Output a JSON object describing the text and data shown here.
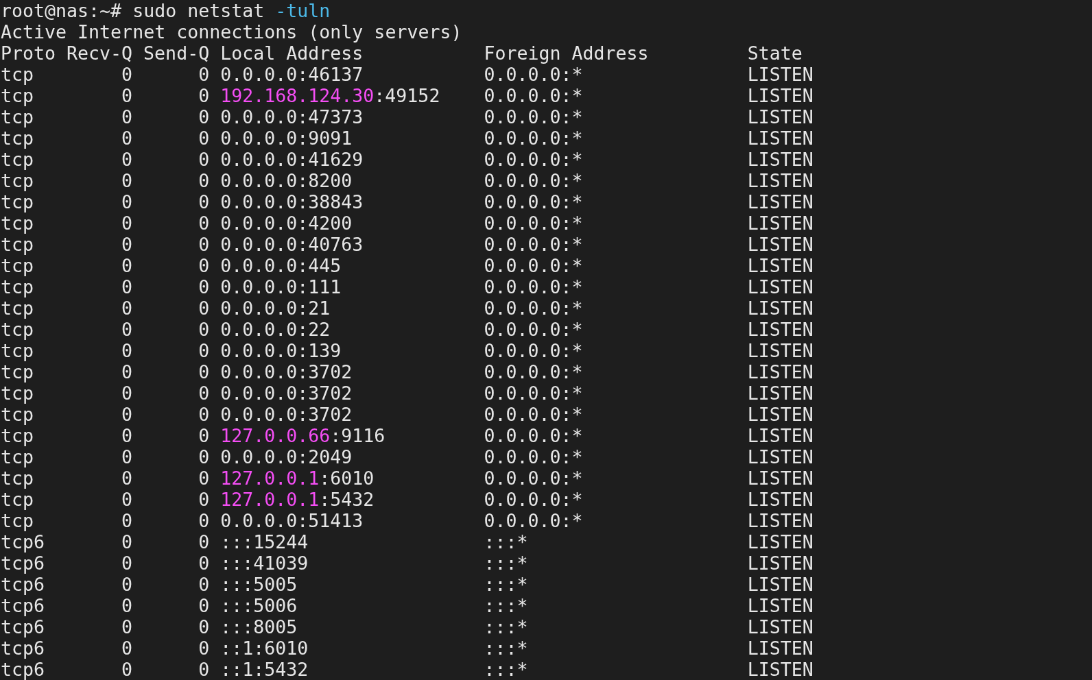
{
  "terminal": {
    "prompt": "root@nas:~#",
    "command": "sudo netstat",
    "option": "-tuln",
    "title": "Active Internet connections (only servers)",
    "table": {
      "columns": [
        "Proto",
        "Recv-Q",
        "Send-Q",
        "Local Address",
        "Foreign Address",
        "State"
      ],
      "rows": [
        {
          "proto": "tcp",
          "recv_q": "0",
          "send_q": "0",
          "local_address": {
            "host": "0.0.0.0",
            "port": ":46137",
            "highlighted": false
          },
          "foreign_address": "0.0.0.0:*",
          "state": "LISTEN"
        },
        {
          "proto": "tcp",
          "recv_q": "0",
          "send_q": "0",
          "local_address": {
            "host": "192.168.124.30",
            "port": ":49152",
            "highlighted": true
          },
          "foreign_address": "0.0.0.0:*",
          "state": "LISTEN"
        },
        {
          "proto": "tcp",
          "recv_q": "0",
          "send_q": "0",
          "local_address": {
            "host": "0.0.0.0",
            "port": ":47373",
            "highlighted": false
          },
          "foreign_address": "0.0.0.0:*",
          "state": "LISTEN"
        },
        {
          "proto": "tcp",
          "recv_q": "0",
          "send_q": "0",
          "local_address": {
            "host": "0.0.0.0",
            "port": ":9091",
            "highlighted": false
          },
          "foreign_address": "0.0.0.0:*",
          "state": "LISTEN"
        },
        {
          "proto": "tcp",
          "recv_q": "0",
          "send_q": "0",
          "local_address": {
            "host": "0.0.0.0",
            "port": ":41629",
            "highlighted": false
          },
          "foreign_address": "0.0.0.0:*",
          "state": "LISTEN"
        },
        {
          "proto": "tcp",
          "recv_q": "0",
          "send_q": "0",
          "local_address": {
            "host": "0.0.0.0",
            "port": ":8200",
            "highlighted": false
          },
          "foreign_address": "0.0.0.0:*",
          "state": "LISTEN"
        },
        {
          "proto": "tcp",
          "recv_q": "0",
          "send_q": "0",
          "local_address": {
            "host": "0.0.0.0",
            "port": ":38843",
            "highlighted": false
          },
          "foreign_address": "0.0.0.0:*",
          "state": "LISTEN"
        },
        {
          "proto": "tcp",
          "recv_q": "0",
          "send_q": "0",
          "local_address": {
            "host": "0.0.0.0",
            "port": ":4200",
            "highlighted": false
          },
          "foreign_address": "0.0.0.0:*",
          "state": "LISTEN"
        },
        {
          "proto": "tcp",
          "recv_q": "0",
          "send_q": "0",
          "local_address": {
            "host": "0.0.0.0",
            "port": ":40763",
            "highlighted": false
          },
          "foreign_address": "0.0.0.0:*",
          "state": "LISTEN"
        },
        {
          "proto": "tcp",
          "recv_q": "0",
          "send_q": "0",
          "local_address": {
            "host": "0.0.0.0",
            "port": ":445",
            "highlighted": false
          },
          "foreign_address": "0.0.0.0:*",
          "state": "LISTEN"
        },
        {
          "proto": "tcp",
          "recv_q": "0",
          "send_q": "0",
          "local_address": {
            "host": "0.0.0.0",
            "port": ":111",
            "highlighted": false
          },
          "foreign_address": "0.0.0.0:*",
          "state": "LISTEN"
        },
        {
          "proto": "tcp",
          "recv_q": "0",
          "send_q": "0",
          "local_address": {
            "host": "0.0.0.0",
            "port": ":21",
            "highlighted": false
          },
          "foreign_address": "0.0.0.0:*",
          "state": "LISTEN"
        },
        {
          "proto": "tcp",
          "recv_q": "0",
          "send_q": "0",
          "local_address": {
            "host": "0.0.0.0",
            "port": ":22",
            "highlighted": false
          },
          "foreign_address": "0.0.0.0:*",
          "state": "LISTEN"
        },
        {
          "proto": "tcp",
          "recv_q": "0",
          "send_q": "0",
          "local_address": {
            "host": "0.0.0.0",
            "port": ":139",
            "highlighted": false
          },
          "foreign_address": "0.0.0.0:*",
          "state": "LISTEN"
        },
        {
          "proto": "tcp",
          "recv_q": "0",
          "send_q": "0",
          "local_address": {
            "host": "0.0.0.0",
            "port": ":3702",
            "highlighted": false
          },
          "foreign_address": "0.0.0.0:*",
          "state": "LISTEN"
        },
        {
          "proto": "tcp",
          "recv_q": "0",
          "send_q": "0",
          "local_address": {
            "host": "0.0.0.0",
            "port": ":3702",
            "highlighted": false
          },
          "foreign_address": "0.0.0.0:*",
          "state": "LISTEN"
        },
        {
          "proto": "tcp",
          "recv_q": "0",
          "send_q": "0",
          "local_address": {
            "host": "0.0.0.0",
            "port": ":3702",
            "highlighted": false
          },
          "foreign_address": "0.0.0.0:*",
          "state": "LISTEN"
        },
        {
          "proto": "tcp",
          "recv_q": "0",
          "send_q": "0",
          "local_address": {
            "host": "127.0.0.66",
            "port": ":9116",
            "highlighted": true
          },
          "foreign_address": "0.0.0.0:*",
          "state": "LISTEN"
        },
        {
          "proto": "tcp",
          "recv_q": "0",
          "send_q": "0",
          "local_address": {
            "host": "0.0.0.0",
            "port": ":2049",
            "highlighted": false
          },
          "foreign_address": "0.0.0.0:*",
          "state": "LISTEN"
        },
        {
          "proto": "tcp",
          "recv_q": "0",
          "send_q": "0",
          "local_address": {
            "host": "127.0.0.1",
            "port": ":6010",
            "highlighted": true
          },
          "foreign_address": "0.0.0.0:*",
          "state": "LISTEN"
        },
        {
          "proto": "tcp",
          "recv_q": "0",
          "send_q": "0",
          "local_address": {
            "host": "127.0.0.1",
            "port": ":5432",
            "highlighted": true
          },
          "foreign_address": "0.0.0.0:*",
          "state": "LISTEN"
        },
        {
          "proto": "tcp",
          "recv_q": "0",
          "send_q": "0",
          "local_address": {
            "host": "0.0.0.0",
            "port": ":51413",
            "highlighted": false
          },
          "foreign_address": "0.0.0.0:*",
          "state": "LISTEN"
        },
        {
          "proto": "tcp6",
          "recv_q": "0",
          "send_q": "0",
          "local_address": {
            "host": "::",
            "port": ":15244",
            "highlighted": false
          },
          "foreign_address": ":::*",
          "state": "LISTEN"
        },
        {
          "proto": "tcp6",
          "recv_q": "0",
          "send_q": "0",
          "local_address": {
            "host": "::",
            "port": ":41039",
            "highlighted": false
          },
          "foreign_address": ":::*",
          "state": "LISTEN"
        },
        {
          "proto": "tcp6",
          "recv_q": "0",
          "send_q": "0",
          "local_address": {
            "host": "::",
            "port": ":5005",
            "highlighted": false
          },
          "foreign_address": ":::*",
          "state": "LISTEN"
        },
        {
          "proto": "tcp6",
          "recv_q": "0",
          "send_q": "0",
          "local_address": {
            "host": "::",
            "port": ":5006",
            "highlighted": false
          },
          "foreign_address": ":::*",
          "state": "LISTEN"
        },
        {
          "proto": "tcp6",
          "recv_q": "0",
          "send_q": "0",
          "local_address": {
            "host": "::",
            "port": ":8005",
            "highlighted": false
          },
          "foreign_address": ":::*",
          "state": "LISTEN"
        },
        {
          "proto": "tcp6",
          "recv_q": "0",
          "send_q": "0",
          "local_address": {
            "host": "::1",
            "port": ":6010",
            "highlighted": false
          },
          "foreign_address": ":::*",
          "state": "LISTEN"
        },
        {
          "proto": "tcp6",
          "recv_q": "0",
          "send_q": "0",
          "local_address": {
            "host": "::1",
            "port": ":5432",
            "highlighted": false
          },
          "foreign_address": ":::*",
          "state": "LISTEN"
        }
      ]
    }
  }
}
